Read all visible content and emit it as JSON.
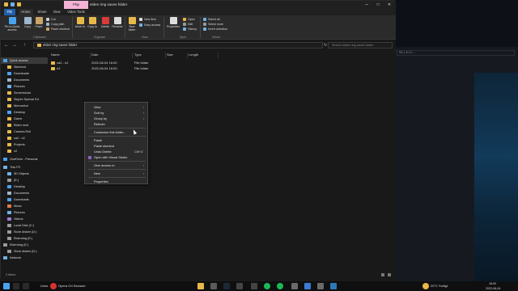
{
  "window": {
    "title": "elden ring saves folder",
    "play_tab": "Play",
    "minimize": "–",
    "maximize": "□",
    "close": "✕"
  },
  "tabs": [
    "File",
    "Home",
    "Share",
    "View",
    "Video Tools"
  ],
  "ribbon": {
    "pin_label": "Pin to Quick access",
    "copy_label": "Copy",
    "paste_label": "Paste",
    "cut": "Cut",
    "copy_path": "Copy path",
    "paste_shortcut": "Paste shortcut",
    "clipboard_group": "Clipboard",
    "move_to": "Move to",
    "copy_to": "Copy to",
    "delete": "Delete",
    "rename": "Rename",
    "organize_group": "Organize",
    "new_folder": "New folder",
    "new_item": "New item",
    "easy_access": "Easy access",
    "new_group": "New",
    "properties": "Properties",
    "open": "Open",
    "edit": "Edit",
    "history": "History",
    "open_group": "Open",
    "select_all": "Select all",
    "select_none": "Select none",
    "invert_selection": "Invert selection",
    "select_group": "Select"
  },
  "nav": {
    "back": "←",
    "forward": "→",
    "up": "↑",
    "address": "elden ring saves folder",
    "search_placeholder": "Search elden ring saves folder",
    "refresh": "↻"
  },
  "sidebar": {
    "items": [
      {
        "label": "Quick access",
        "color": "#4aa3f0"
      },
      {
        "label": "Skinbord",
        "color": "#e8b94a"
      },
      {
        "label": "Downloads",
        "color": "#4aa3f0"
      },
      {
        "label": "Documents",
        "color": "#9fb6cc"
      },
      {
        "label": "Pictures",
        "color": "#6fb2e6"
      },
      {
        "label": "Screenshots",
        "color": "#e8b94a"
      },
      {
        "label": "Skyrim Special Ed",
        "color": "#e8b94a"
      },
      {
        "label": "Morrowind",
        "color": "#e8b94a"
      },
      {
        "label": "Desktop",
        "color": "#4aa3f0"
      },
      {
        "label": "Game",
        "color": "#e8b94a"
      },
      {
        "label": "Elden mod",
        "color": "#e8b94a"
      },
      {
        "label": "Camera Roll",
        "color": "#e8b94a"
      },
      {
        "label": "ca2 - n2",
        "color": "#e8b94a"
      },
      {
        "label": "Projects",
        "color": "#e8b94a"
      },
      {
        "label": "n2",
        "color": "#e8b94a"
      },
      {
        "label": "OneDrive - Personal",
        "color": "#4aa3f0"
      },
      {
        "label": "This PC",
        "color": "#6fb2e6"
      },
      {
        "label": "3D Objects",
        "color": "#6fb2e6"
      },
      {
        "label": "(E:)",
        "color": "#9a9a9a"
      },
      {
        "label": "Desktop",
        "color": "#4aa3f0"
      },
      {
        "label": "Documents",
        "color": "#9fb6cc"
      },
      {
        "label": "Downloads",
        "color": "#4aa3f0"
      },
      {
        "label": "Music",
        "color": "#e07a4a"
      },
      {
        "label": "Pictures",
        "color": "#6fb2e6"
      },
      {
        "label": "Videos",
        "color": "#a07ad0"
      },
      {
        "label": "Local Disk (C:)",
        "color": "#9a9a9a"
      },
      {
        "label": "Store disken (D:)",
        "color": "#9a9a9a"
      },
      {
        "label": "Eldenring (E:)",
        "color": "#9a9a9a"
      },
      {
        "label": "Eldenring (E:)",
        "color": "#9a9a9a"
      },
      {
        "label": "Store disken (D:)",
        "color": "#9a9a9a"
      },
      {
        "label": "Network",
        "color": "#6fb2e6"
      }
    ]
  },
  "columns": [
    "Name",
    "Date",
    "Type",
    "Size",
    "Length"
  ],
  "files": [
    {
      "name": "ca2 - n2",
      "date": "2022-06-04 16:00",
      "type": "File folder"
    },
    {
      "name": "n2",
      "date": "2022-06-04 16:00",
      "type": "File folder"
    }
  ],
  "context_menu": {
    "items": [
      {
        "label": "View",
        "arrow": "›"
      },
      {
        "label": "Sort by",
        "arrow": "›"
      },
      {
        "label": "Group by",
        "arrow": "›"
      },
      {
        "label": "Refresh"
      },
      {
        "sep": true
      },
      {
        "label": "Customise this folder..."
      },
      {
        "sep": true
      },
      {
        "label": "Paste"
      },
      {
        "label": "Paste shortcut"
      },
      {
        "label": "Undo Delete",
        "shortcut": "Ctrl+Z"
      },
      {
        "label": "Open with Visual Studio",
        "icon": true
      },
      {
        "sep": true
      },
      {
        "label": "Give access to",
        "arrow": "›"
      },
      {
        "sep": true
      },
      {
        "label": "New",
        "arrow": "›"
      },
      {
        "sep": true
      },
      {
        "label": "Properties"
      }
    ]
  },
  "status": {
    "items_count": "2 items"
  },
  "taskbar": {
    "search_text": "Links",
    "browser_label": "Opera GX Browser",
    "weather": "20°C Solligt",
    "time": "16:00",
    "date": "2022-06-04"
  },
  "background": {
    "address_hint": "S5-1-5-21-..."
  }
}
